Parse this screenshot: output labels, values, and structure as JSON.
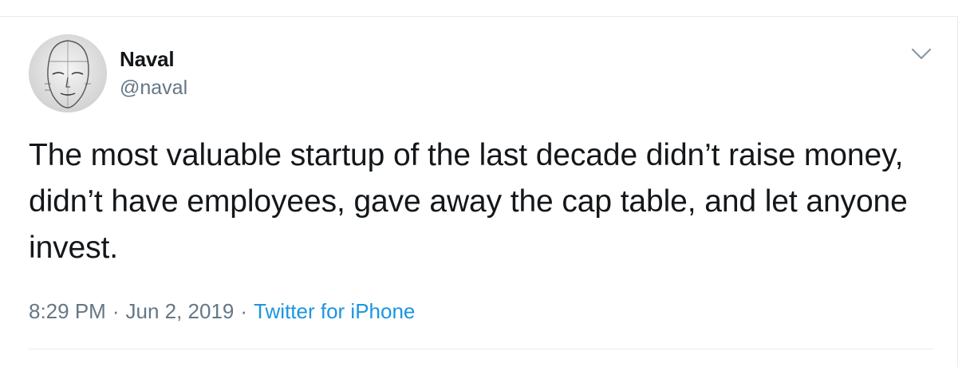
{
  "tweet": {
    "author": {
      "display_name": "Naval",
      "handle": "@naval",
      "avatar_icon": "sketch-face-avatar"
    },
    "menu_icon": "chevron-down-icon",
    "text": "The most valuable startup of the last decade didn’t raise money, didn’t have employees, gave away the cap table, and let anyone invest.",
    "meta": {
      "time": "8:29 PM",
      "separator": "·",
      "date": "Jun 2, 2019",
      "source": "Twitter for iPhone"
    },
    "colors": {
      "text": "#14171a",
      "secondary": "#657786",
      "link": "#1b95e0",
      "border": "#e6ecf0"
    }
  }
}
